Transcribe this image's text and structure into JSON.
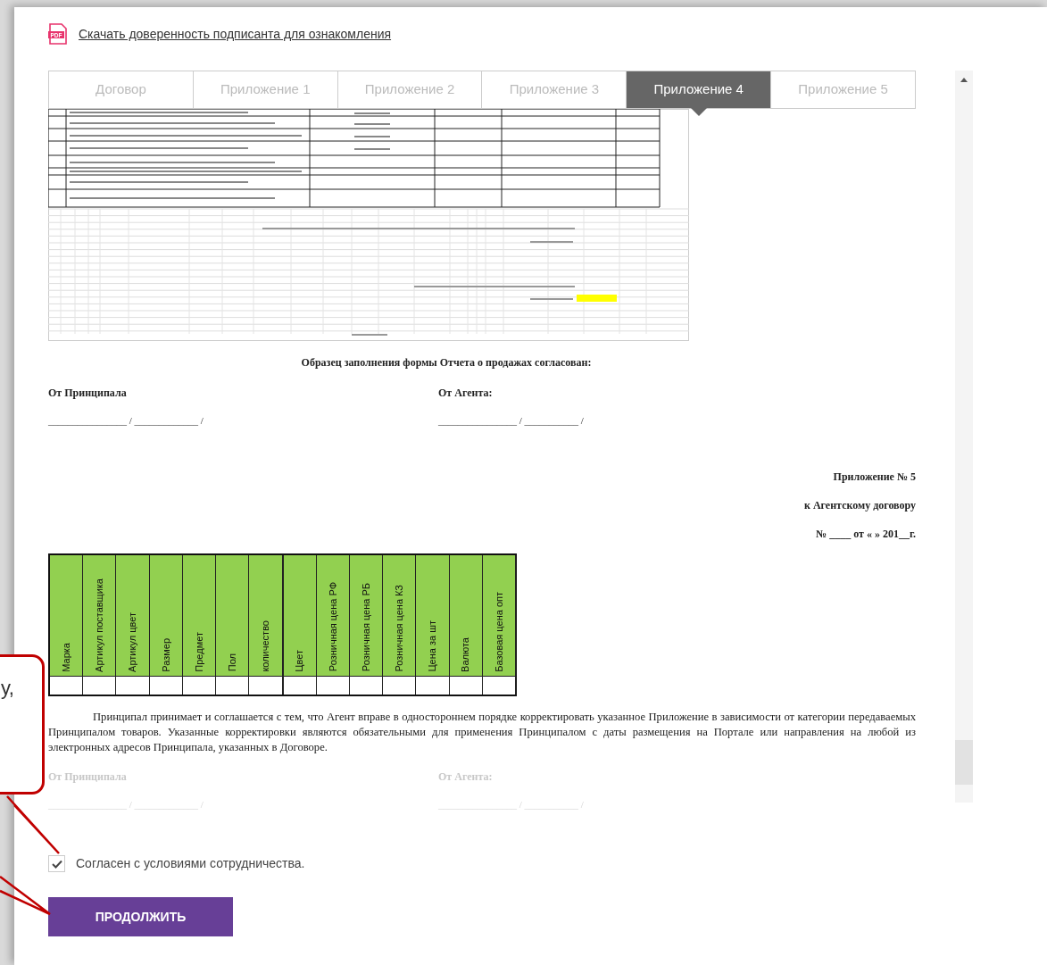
{
  "download_link": {
    "icon_text": "PDF",
    "label": "Скачать доверенность подписанта для ознакомления"
  },
  "tabs": [
    {
      "label": "Договор",
      "selected": false
    },
    {
      "label": "Приложение 1",
      "selected": false
    },
    {
      "label": "Приложение 2",
      "selected": false
    },
    {
      "label": "Приложение 3",
      "selected": false
    },
    {
      "label": "Приложение 4",
      "selected": true
    },
    {
      "label": "Приложение 5",
      "selected": false
    }
  ],
  "document": {
    "approval_heading": "Образец заполнения формы Отчета о продажах согласован:",
    "signatures": [
      {
        "party": "От Принципала",
        "line": "________________ / _____________ /"
      },
      {
        "party": "От Агента:",
        "line": "________________ / ___________ /"
      }
    ],
    "appendix_header": [
      "Приложение № 5",
      "к Агентскому договору",
      "№ ____ от « » 201__г."
    ],
    "table": {
      "columns": [
        "Марка",
        "Артикул поставщика",
        "Артикул цвет",
        "Размер",
        "Предмет",
        "Пол",
        "количество",
        "Цвет",
        "Розничная цена РФ",
        "Розничная цена РБ",
        "Розничная цена КЗ",
        "Цена за шт",
        "Валюта",
        "Базовая цена опт"
      ]
    },
    "paragraph": "Принципал принимает и соглашается с тем, что Агент вправе в одностороннем порядке корректировать указанное Приложение в зависимости от категории передаваемых Принципалом товаров. Указанные корректировки являются обязательными для применения Принципалом с даты размещения на Портале или направления на любой из электронных адресов Принципала, указанных в Договоре.",
    "faded_signatures": [
      {
        "party": "От Принципала",
        "line": "________________ / _____________ /"
      },
      {
        "party": "От Агента:",
        "line": "________________ / ___________ /"
      }
    ]
  },
  "agreement": {
    "label": "Согласен с условиями сотрудничества.",
    "checked": true
  },
  "continue_button": {
    "label": "ПРОДОЛЖИТЬ"
  },
  "callout": {
    "text": "у,"
  }
}
